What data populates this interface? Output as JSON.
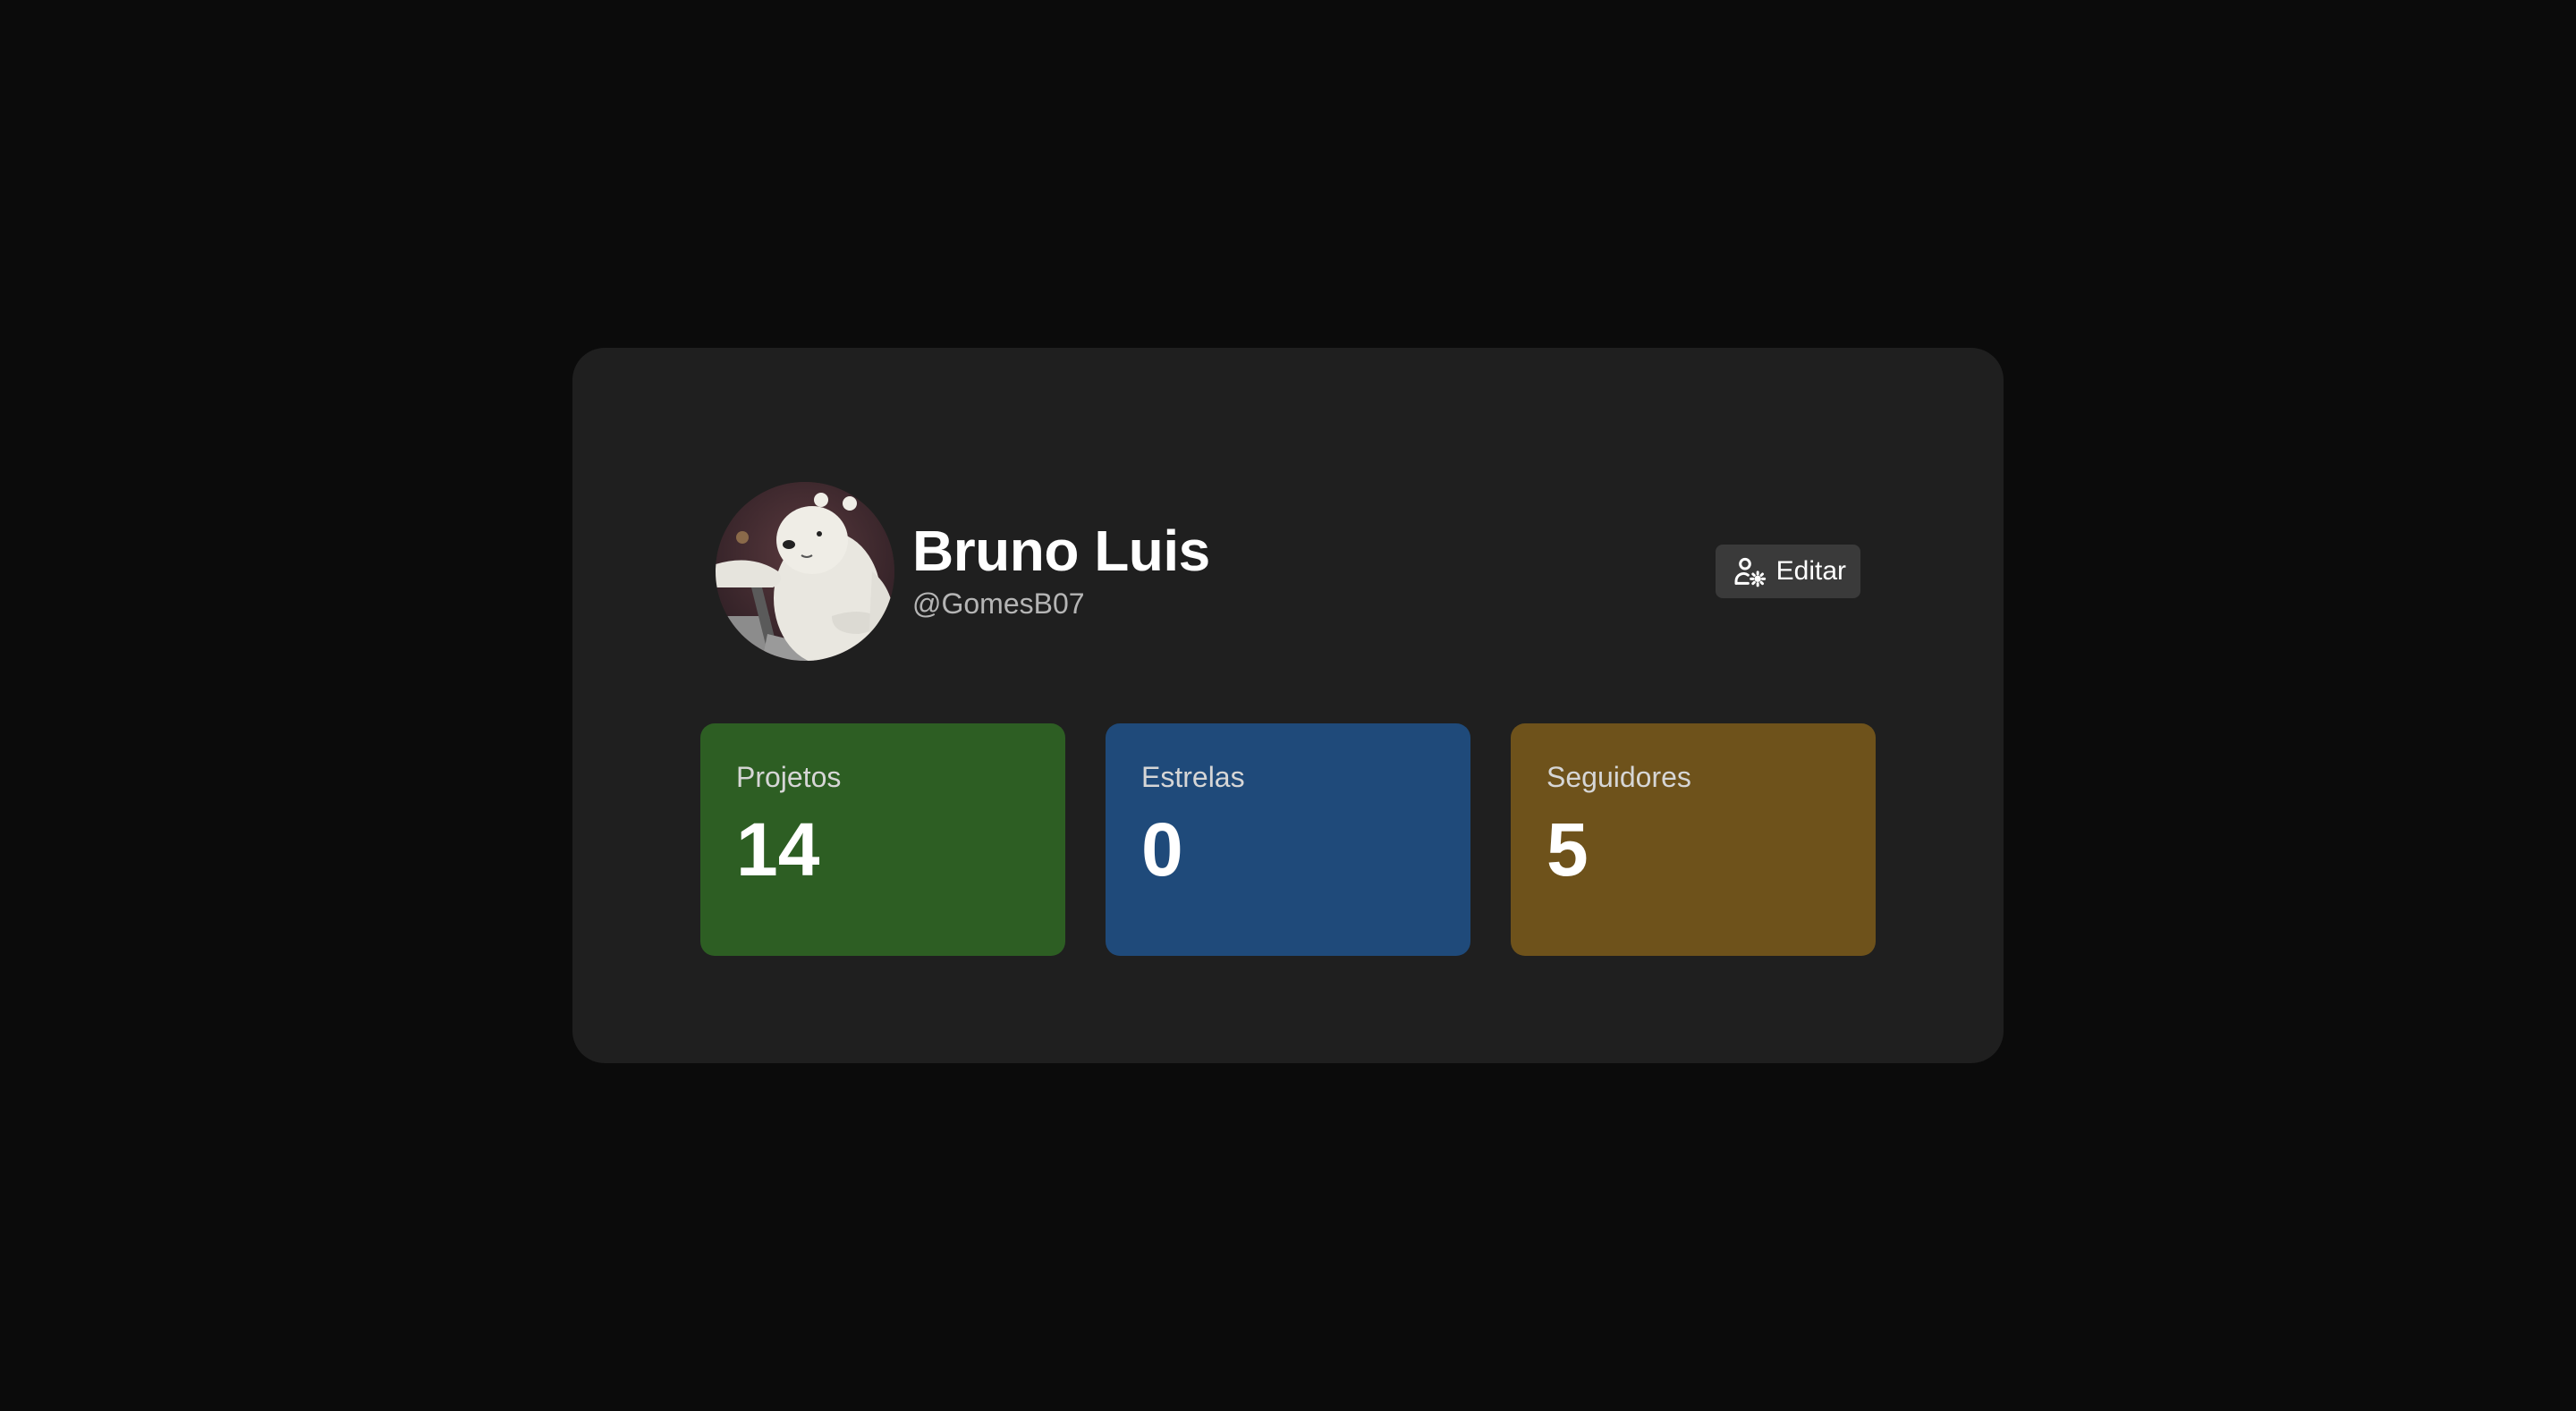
{
  "profile": {
    "name": "Bruno Luis",
    "handle": "@GomesB07",
    "avatar_icon": "polar-bear-avatar"
  },
  "actions": {
    "edit_label": "Editar",
    "edit_icon": "user-gear-icon"
  },
  "stats": [
    {
      "label": "Projetos",
      "value": "14",
      "color": "#2d5e23"
    },
    {
      "label": "Estrelas",
      "value": "0",
      "color": "#1f4a7a"
    },
    {
      "label": "Seguidores",
      "value": "5",
      "color": "#6e521b"
    }
  ],
  "colors": {
    "background": "#0b0b0b",
    "card": "#1f1f1f",
    "button": "#3a3a3a"
  }
}
